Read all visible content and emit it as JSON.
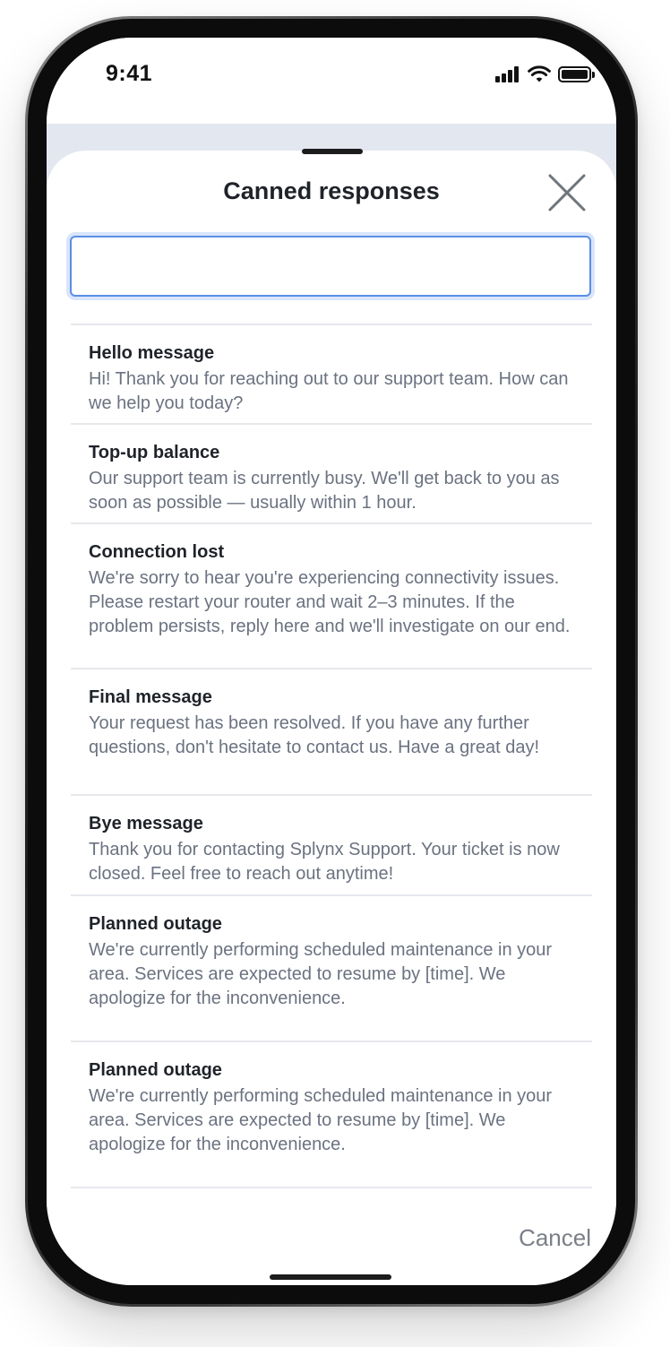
{
  "status_bar": {
    "time": "9:41",
    "icons": [
      "signal-icon",
      "wifi-icon",
      "battery-icon"
    ]
  },
  "sheet": {
    "title": "Canned responses",
    "close_icon": "close-icon",
    "search": {
      "value": "",
      "placeholder": ""
    },
    "responses": [
      {
        "title": "Hello message",
        "text": "Hi! Thank you for reaching out to our support team. How can we help you today?"
      },
      {
        "title": "Top-up balance",
        "text": "Our support team is currently busy. We'll get back to you as soon as possible — usually within 1 hour."
      },
      {
        "title": "Connection lost",
        "text": "We're sorry to hear you're experiencing connectivity issues. Please restart your router and wait 2–3 minutes. If the problem persists, reply here and we'll investigate on our end."
      },
      {
        "title": "Final message",
        "text": "Your request has been resolved. If you have any further questions, don't hesitate to contact us. Have a great day!"
      },
      {
        "title": "Bye message",
        "text": "Thank you for contacting Splynx Support. Your ticket is now closed. Feel free to reach out anytime!"
      },
      {
        "title": "Planned outage",
        "text": "We're currently performing scheduled maintenance in your area. Services are expected to resume by [time]. We apologize for the inconvenience."
      },
      {
        "title": "Planned outage",
        "text": "We're currently performing scheduled maintenance in your area. Services are expected to resume by [time]. We apologize for the inconvenience."
      }
    ],
    "cancel_label": "Cancel"
  },
  "colors": {
    "input_border": "#5b8ee6",
    "input_focus_ring": "#d8e5fb",
    "title_text": "#1f2329",
    "body_text": "#6b7280",
    "divider": "#e6e8ec",
    "backdrop": "#e3e7ef"
  }
}
